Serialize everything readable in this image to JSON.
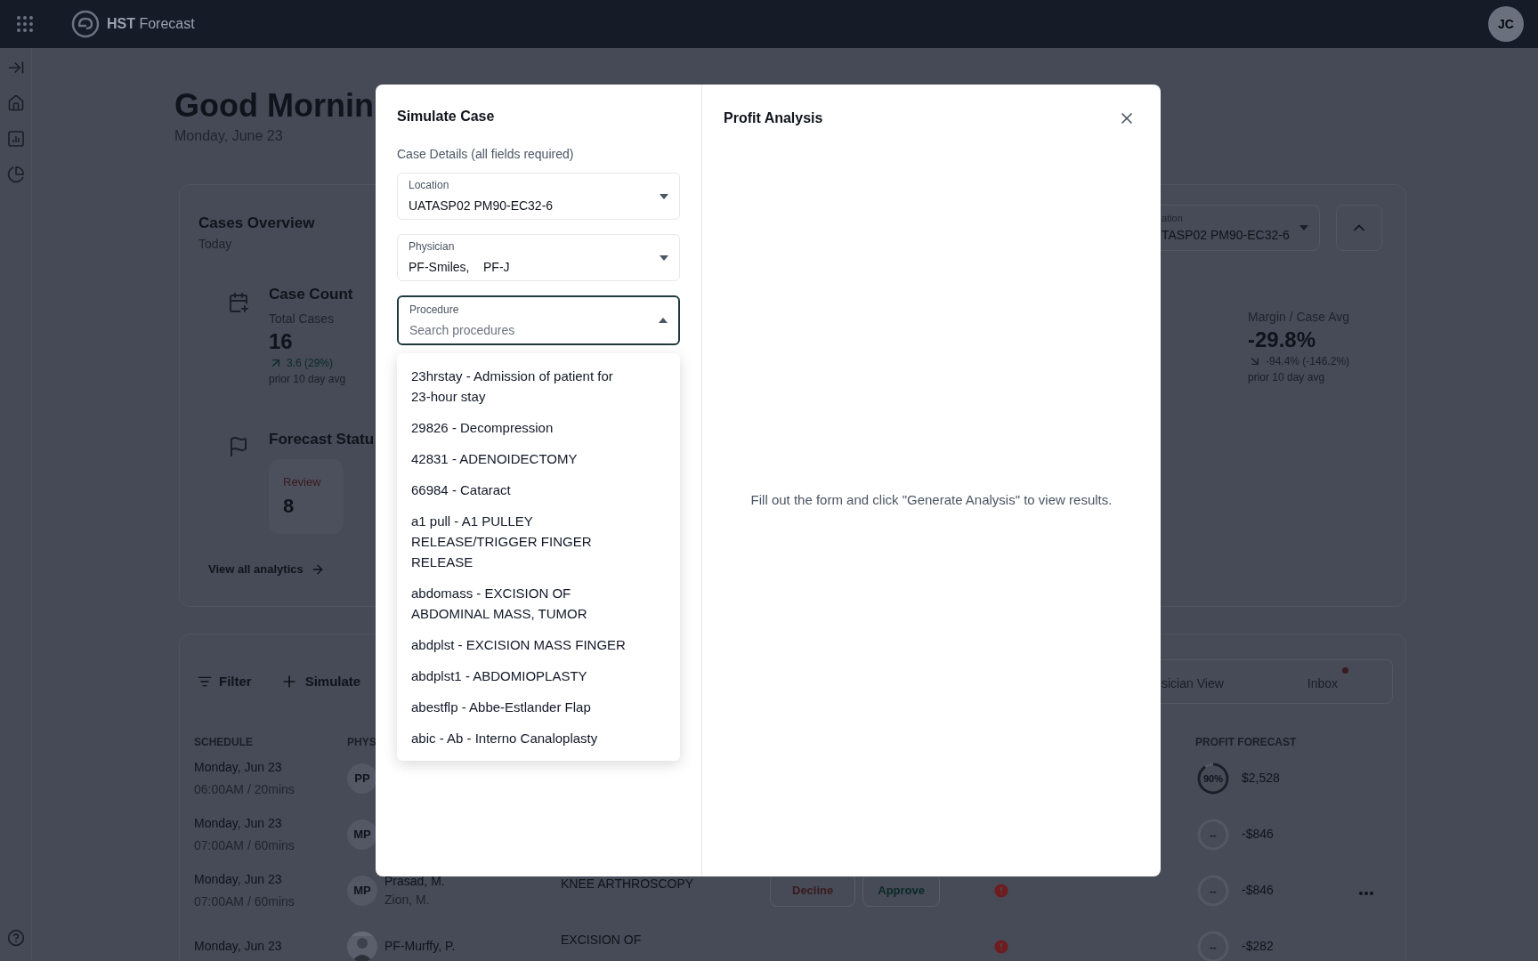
{
  "header": {
    "brand": "**HST** Forecast",
    "avatar": "JC"
  },
  "greeting": {
    "title": "Good Mornin",
    "date": "Monday, June 23"
  },
  "overview": {
    "title": "Cases Overview",
    "subtitle": "Today",
    "location_select": {
      "label": "ation",
      "value": "TASP02 PM90-EC32-6",
      "expanded": false
    },
    "case_count": {
      "title": "Case Count",
      "label": "Total Cases",
      "value": "16",
      "rising": true,
      "change": "3.6 (29%)",
      "note": "prior 10 day avg"
    },
    "margin": {
      "label": "Margin / Case Avg",
      "value": "-29.8%",
      "rising": false,
      "change": "-94.4% (-146.2%)",
      "note": "prior 10 day avg"
    },
    "forecast_status": {
      "title": "Forecast Statu",
      "review_label": "Review",
      "review_value": "8"
    },
    "link": "View all analytics"
  },
  "toolbar": {
    "filter": "Filter",
    "simulate": "Simulate",
    "tabs": [
      {
        "label": "sician View",
        "unread": false
      },
      {
        "label": "Inbox",
        "unread": true
      }
    ]
  },
  "table": {
    "columns": [
      "SCHEDULE",
      "PHYS",
      "PROFIT FORECAST"
    ],
    "rows": [
      {
        "date": "Monday, Jun 23",
        "time": "06:00AM / 20mins",
        "initials": "PP",
        "ring": "90%",
        "level": 0.9,
        "profit": "$2,528"
      },
      {
        "date": "Monday, Jun 23",
        "time": "07:00AM / 60mins",
        "initials": "MP",
        "ring": "--",
        "profit": "-$846"
      },
      {
        "date": "Monday, Jun 23",
        "time": "07:00AM / 60mins",
        "initials": "MP",
        "physicians": [
          "Prasad, M.",
          "Zion, M."
        ],
        "procedure": "KNEE ARTHROSCOPY",
        "actions": [
          "Decline",
          "Approve"
        ],
        "alert": true,
        "ring": "--",
        "profit": "-$846",
        "more": true
      },
      {
        "date": "Monday, Jun 23",
        "kind": "picture",
        "physicians": [
          "PF-Murffy, P."
        ],
        "procedure": "EXCISION OF",
        "alert": true,
        "ring": "--",
        "profit": "-$282"
      }
    ]
  },
  "modal": {
    "title": "Simulate Case",
    "section": "Case Details (all fields required)",
    "fields": [
      {
        "label": "Location",
        "value": "UATASP02 PM90-EC32-6",
        "expanded": false
      },
      {
        "label": "Physician",
        "value": "PF-Smiles,    PF-J",
        "expanded": false
      },
      {
        "label": "Procedure",
        "placeholder": "Search procedures",
        "expanded": true
      }
    ],
    "options": [
      "23hrstay - Admission of patient for 23-hour stay",
      "29826 - Decompression",
      "42831 - ADENOIDECTOMY",
      "66984 - Cataract",
      "a1 pull - A1 PULLEY RELEASE/TRIGGER FINGER RELEASE",
      "abdomass - EXCISION OF ABDOMINAL MASS, TUMOR",
      "abdplst - EXCISION MASS FINGER",
      "abdplst1 - ABDOMIOPLASTY",
      "abestflp - Abbe-Estlander Flap",
      "abic - Ab - Interno Canaloplasty"
    ],
    "analysis_title": "Profit Analysis",
    "empty_message": "Fill out the form and click \"Generate Analysis\" to view results."
  }
}
